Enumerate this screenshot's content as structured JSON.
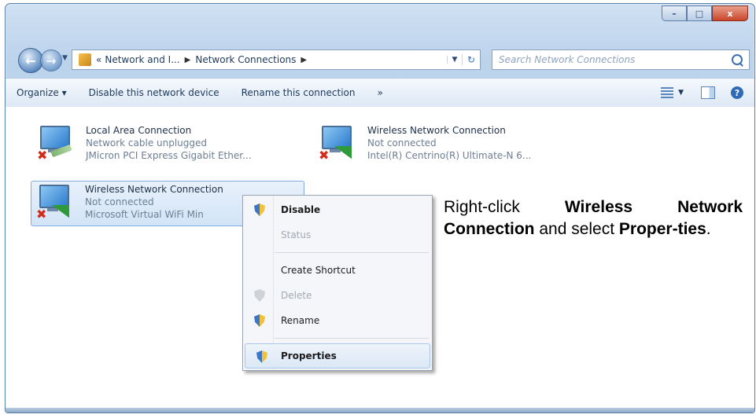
{
  "window": {
    "minimize": "–",
    "maximize": "□",
    "close": "x"
  },
  "address": {
    "crumb_prefix": "«",
    "crumb1": "Network and I...",
    "crumb2": "Network Connections",
    "search_placeholder": "Search Network Connections"
  },
  "toolbar": {
    "organize": "Organize ▾",
    "disable": "Disable this network device",
    "rename": "Rename this connection",
    "more": "»"
  },
  "connections": [
    {
      "name": "Local Area Connection",
      "status": "Network cable unplugged",
      "device": "JMicron PCI Express Gigabit Ether..."
    },
    {
      "name": "Wireless Network Connection",
      "status": "Not connected",
      "device": "Intel(R) Centrino(R) Ultimate-N 6..."
    },
    {
      "name": "Wireless Network Connection",
      "status": "Not connected",
      "device": "Microsoft Virtual WiFi Min"
    }
  ],
  "context_menu": {
    "disable": "Disable",
    "status": "Status",
    "create_shortcut": "Create Shortcut",
    "delete": "Delete",
    "rename": "Rename",
    "properties": "Properties"
  },
  "instruction": {
    "p1": "Right-click ",
    "b1": "Wireless Network Connection",
    "p2": " and select ",
    "b2": "Proper-ties",
    "p3": "."
  },
  "colors": {
    "frame": "#bcd3ec",
    "selection": "#d2e4f7",
    "link_text": "#1e395b"
  }
}
